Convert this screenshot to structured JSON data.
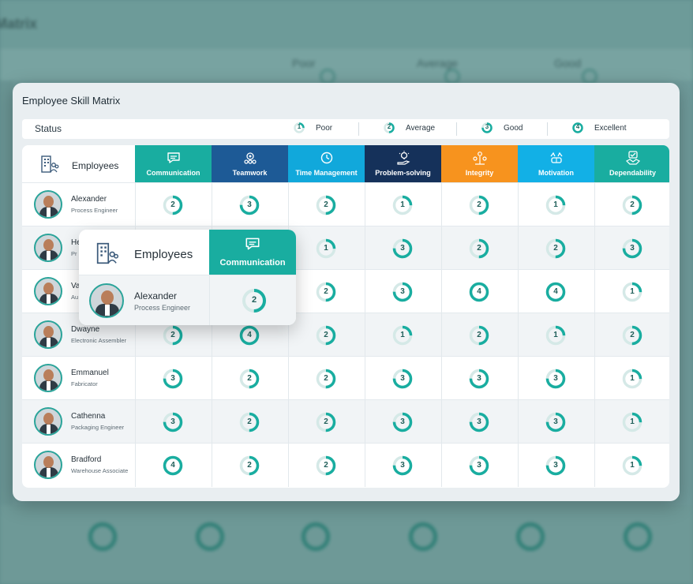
{
  "background": {
    "title": "Matrix",
    "status_items": [
      "Poor",
      "Average",
      "Good"
    ]
  },
  "card": {
    "title": "Employee Skill Matrix",
    "status_label": "Status",
    "legend": [
      {
        "level": "1",
        "label": "Poor"
      },
      {
        "level": "2",
        "label": "Average"
      },
      {
        "level": "3",
        "label": "Good"
      },
      {
        "level": "4",
        "label": "Excellent"
      }
    ]
  },
  "table": {
    "employees_header": "Employees",
    "skills": [
      {
        "label": "Communication",
        "color": "#19ada0",
        "icon": "chat-bubble-icon"
      },
      {
        "label": "Teamwork",
        "color": "#1d5a96",
        "icon": "team-gears-icon"
      },
      {
        "label": "Time Management",
        "color": "#11a8db",
        "icon": "clock-gear-icon"
      },
      {
        "label": "Problem-solving",
        "color": "#15315a",
        "icon": "lightbulb-hand-icon"
      },
      {
        "label": "Integrity",
        "color": "#f7931e",
        "icon": "integrity-people-icon"
      },
      {
        "label": "Motivation",
        "color": "#12b0e6",
        "icon": "motivation-hands-icon"
      },
      {
        "label": "Dependability",
        "color": "#19ada0",
        "icon": "handshake-icon"
      }
    ],
    "rows": [
      {
        "name": "Alexander",
        "role": "Process Engineer",
        "scores": [
          "2",
          "3",
          "2",
          "1",
          "2",
          "1",
          "2"
        ]
      },
      {
        "name": "He",
        "role": "Pr",
        "scores": [
          "",
          "",
          "1",
          "3",
          "2",
          "2",
          "3"
        ]
      },
      {
        "name": "Va",
        "role": "Au",
        "scores": [
          "",
          "",
          "2",
          "3",
          "4",
          "4",
          "1"
        ]
      },
      {
        "name": "Dwayne",
        "role": "Electronic Assembler",
        "scores": [
          "2",
          "4",
          "2",
          "1",
          "2",
          "1",
          "2"
        ]
      },
      {
        "name": "Emmanuel",
        "role": "Fabricator",
        "scores": [
          "3",
          "2",
          "2",
          "3",
          "3",
          "3",
          "1"
        ]
      },
      {
        "name": "Cathenna",
        "role": "Packaging Engineer",
        "scores": [
          "3",
          "2",
          "2",
          "3",
          "3",
          "3",
          "1"
        ]
      },
      {
        "name": "Bradford",
        "role": "Warehouse Associate",
        "scores": [
          "4",
          "2",
          "2",
          "3",
          "3",
          "3",
          "1"
        ]
      }
    ]
  },
  "zoom": {
    "employees_header": "Employees",
    "skill_header": "Communication",
    "name": "Alexander",
    "role": "Process Engineer",
    "score": "2"
  },
  "colors": {
    "accent": "#19ada0",
    "ring_track": "#d5e9e7"
  }
}
